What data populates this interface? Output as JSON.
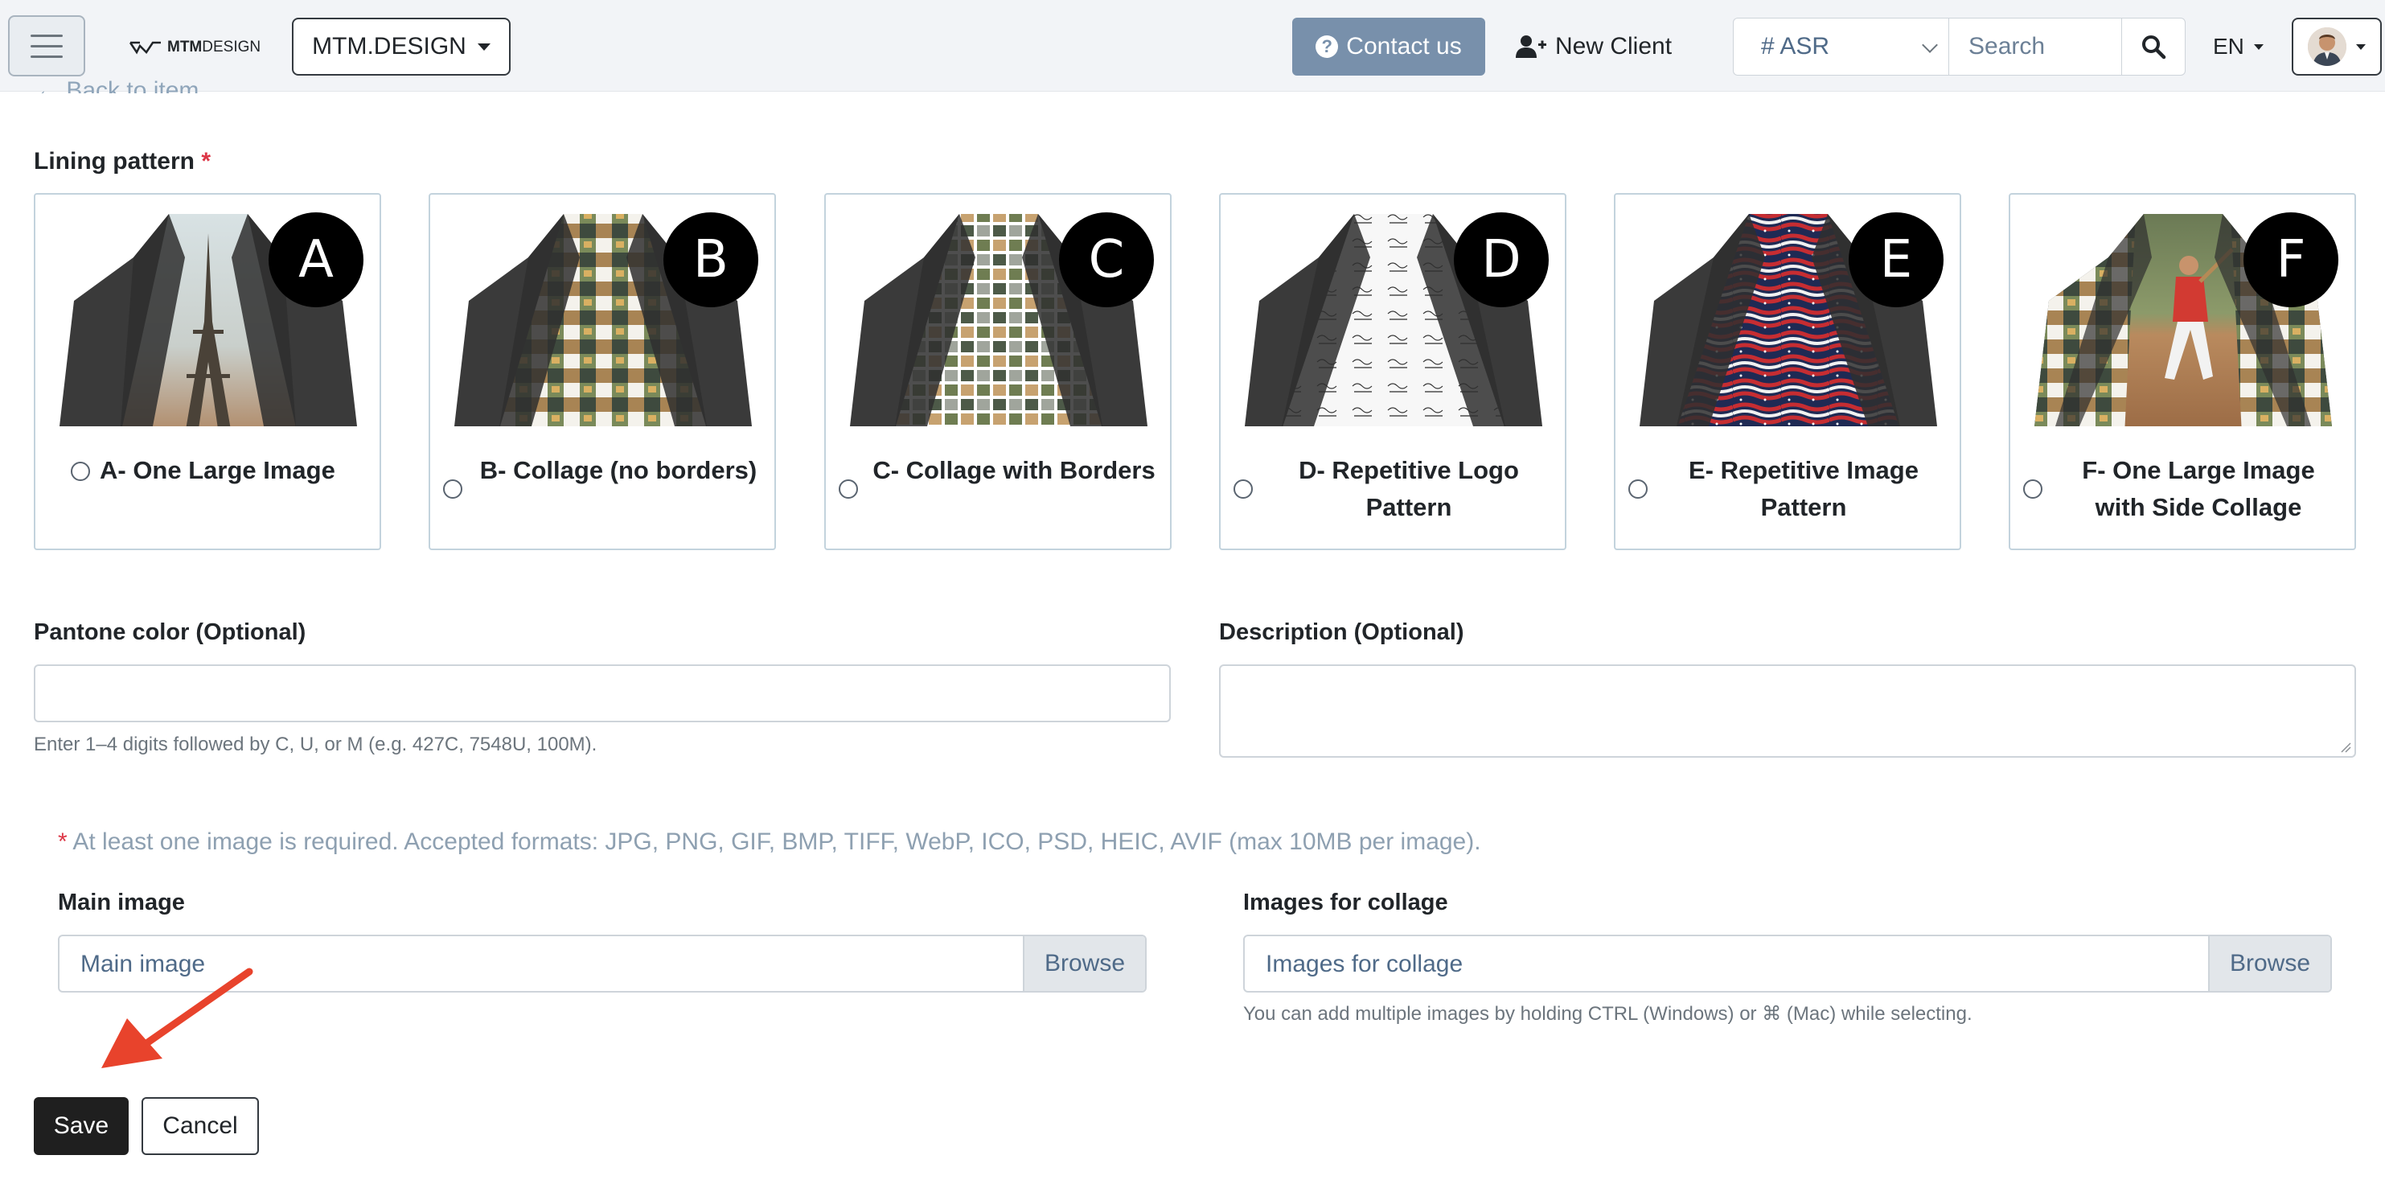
{
  "navbar": {
    "brand_logo": "MTMDESIGN",
    "brand_logo_bold": "MTM",
    "brand_logo_light": "DESIGN",
    "brand_dropdown": "MTM.DESIGN",
    "contact_label": "Contact us",
    "new_client_label": "New Client",
    "asr_value": "# ASR",
    "search_placeholder": "Search",
    "language": "EN"
  },
  "back_link": "Back to item",
  "lining": {
    "label": "Lining pattern",
    "required_mark": "*",
    "options": [
      {
        "badge": "A",
        "label": "A- One Large Image",
        "pattern": "eiffel"
      },
      {
        "badge": "B",
        "label": "B- Collage (no borders)",
        "pattern": "collage"
      },
      {
        "badge": "C",
        "label": "C- Collage with Borders",
        "pattern": "collage-borders"
      },
      {
        "badge": "D",
        "label": "D- Repetitive Logo Pattern",
        "pattern": "logo"
      },
      {
        "badge": "E",
        "label": "E- Repetitive Image Pattern",
        "pattern": "flag"
      },
      {
        "badge": "F",
        "label": "F- One Large Image with Side Collage",
        "pattern": "baseball"
      }
    ]
  },
  "pantone": {
    "label": "Pantone color (Optional)",
    "value": "",
    "help": "Enter 1–4 digits followed by C, U, or M (e.g. 427C, 7548U, 100M)."
  },
  "description": {
    "label": "Description (Optional)",
    "value": ""
  },
  "images": {
    "required_mark": "*",
    "notice": "At least one image is required. Accepted formats: JPG, PNG, GIF, BMP, TIFF, WebP, ICO, PSD, HEIC, AVIF (max 10MB per image).",
    "main_label": "Main image",
    "main_placeholder": "Main image",
    "collage_label": "Images for collage",
    "collage_placeholder": "Images for collage",
    "browse_label": "Browse",
    "collage_help": "You can add multiple images by holding CTRL (Windows) or ⌘ (Mac) while selecting."
  },
  "actions": {
    "save_label": "Save",
    "cancel_label": "Cancel"
  },
  "colors": {
    "accent": "#7890ab",
    "required": "#dc3545",
    "annotation_arrow": "#e8432c"
  }
}
